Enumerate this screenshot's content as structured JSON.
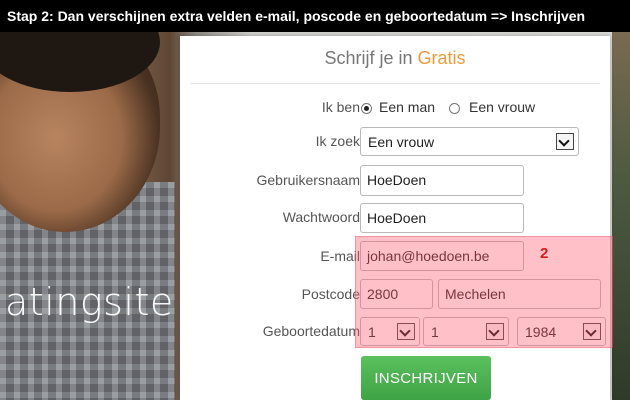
{
  "caption": "Stap 2: Dan verschijnen extra velden e-mail, poscode en geboortedatum => Inschrijven",
  "background_text": "atingsite",
  "form": {
    "title_main": "Schrijf je in",
    "title_accent": "Gratis",
    "accent_color": "#f29a3a",
    "ik_ben": {
      "label": "Ik ben",
      "options": [
        {
          "label": "Een man",
          "selected": true
        },
        {
          "label": "Een vrouw",
          "selected": false
        }
      ]
    },
    "ik_zoek": {
      "label": "Ik zoek",
      "value": "Een vrouw"
    },
    "gebruikersnaam": {
      "label": "Gebruikersnaam",
      "value": "HoeDoen"
    },
    "wachtwoord": {
      "label": "Wachtwoord",
      "value": "HoeDoen"
    },
    "email": {
      "label": "E-mail",
      "value": "johan@hoedoen.be"
    },
    "postcode": {
      "label": "Postcode",
      "code": "2800",
      "city": "Mechelen"
    },
    "geboortedatum": {
      "label": "Geboortedatum",
      "day": "1",
      "month": "1",
      "year": "1984"
    },
    "submit_label": "INSCHRIJVEN",
    "submit_color": "#4cb050"
  },
  "annotation": {
    "number": "2",
    "color": "#d41a1a"
  }
}
